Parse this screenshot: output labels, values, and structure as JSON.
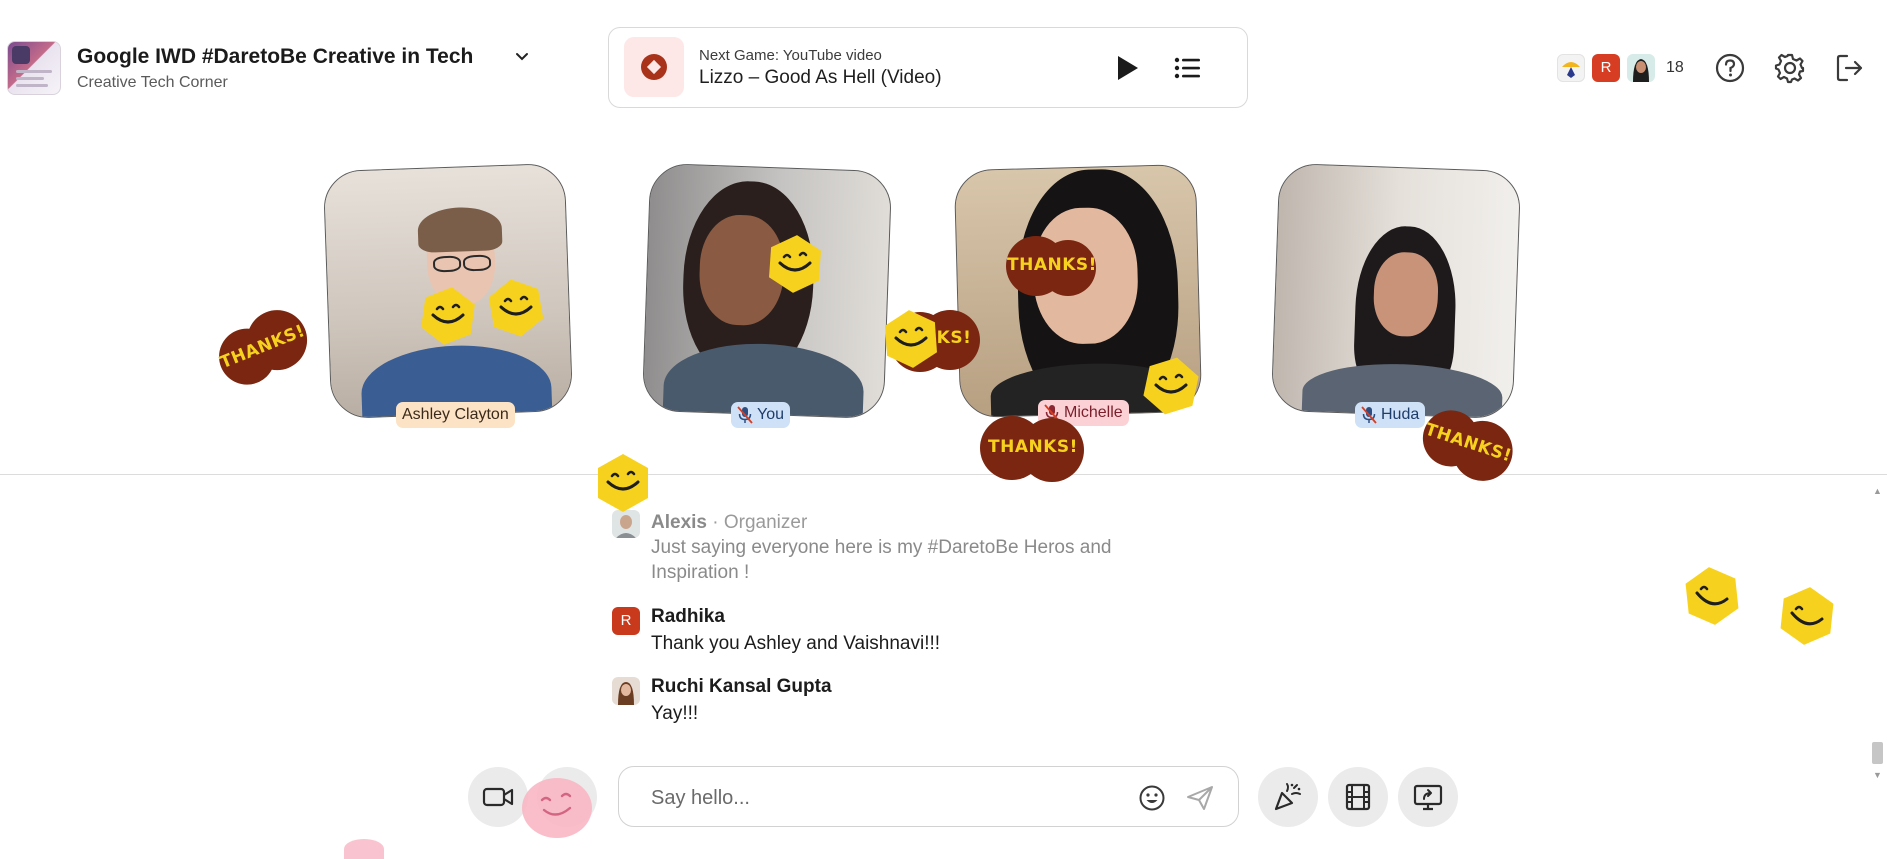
{
  "header": {
    "room_title": "Google IWD #DaretoBe Creative in Tech",
    "room_subtitle": "Creative Tech Corner",
    "participant_count": "18",
    "avatar_initial": "R"
  },
  "now_playing": {
    "eyebrow": "Next Game: YouTube video",
    "title": "Lizzo – Good As Hell (Video)"
  },
  "participants": [
    {
      "name": "Ashley Clayton",
      "muted": false
    },
    {
      "name": "You",
      "muted": true
    },
    {
      "name": "Michelle",
      "muted": true
    },
    {
      "name": "Huda",
      "muted": true
    }
  ],
  "chat": {
    "messages": [
      {
        "author": "Alexis",
        "role": "· Organizer",
        "text": "Just saying everyone here is my #DaretoBe Heros and Inspiration !"
      },
      {
        "author": "Radhika",
        "avatar_initial": "R",
        "text": "Thank you Ashley and Vaishnavi!!!"
      },
      {
        "author": "Ruchi Kansal Gupta",
        "text": "Yay!!!"
      }
    ],
    "input_placeholder": "Say hello..."
  },
  "stickers": {
    "thanks_label": "THANKS!",
    "thanks_partial_label": "KS!"
  },
  "colors": {
    "sticker_yellow": "#f6d21e",
    "sticker_brown": "#7a2610",
    "brand_red": "#c9391c",
    "tag_you_bg": "#cfe1f6",
    "tag_michelle_bg": "#fbd1d5",
    "tag_ashley_bg": "#fde3c6"
  },
  "icons": {
    "game": "diamond-badge-icon",
    "play": "play-icon",
    "queue": "list-icon",
    "help": "help-circle-icon",
    "settings": "gear-icon",
    "leave": "exit-icon",
    "camera": "video-camera-icon",
    "emoji": "smiley-icon",
    "send": "send-icon",
    "effects": "party-popper-icon",
    "film": "film-strip-icon",
    "share_screen": "screen-share-icon"
  }
}
